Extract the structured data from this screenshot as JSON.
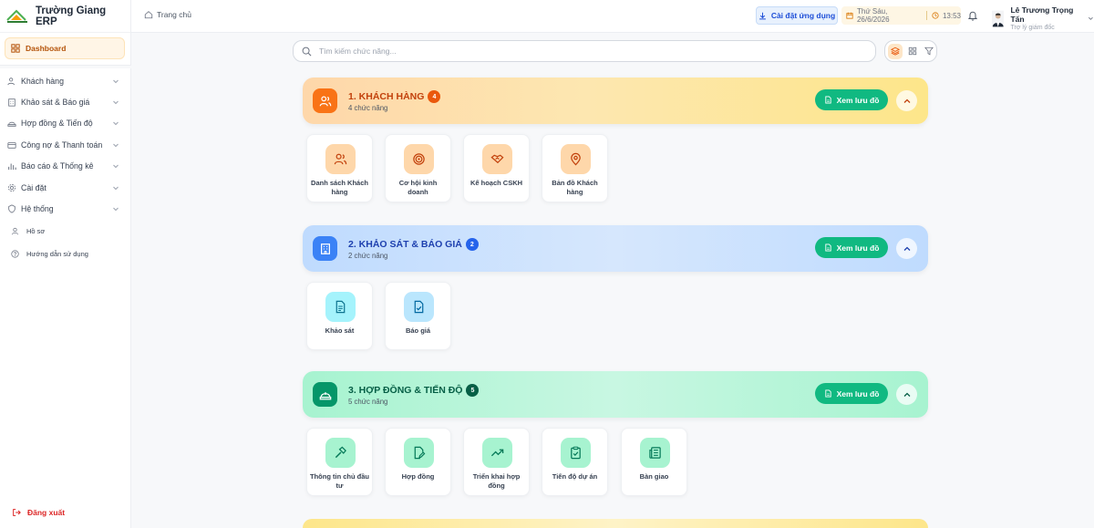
{
  "app": {
    "title": "Trường Giang ERP"
  },
  "sidebar": {
    "dashboard": "Dashboard",
    "items": [
      {
        "label": "Khách hàng",
        "icon": "users-icon"
      },
      {
        "label": "Khảo sát & Báo giá",
        "icon": "building-icon"
      },
      {
        "label": "Hợp đồng & Tiến độ",
        "icon": "hardhat-icon"
      },
      {
        "label": "Công nợ & Thanh toán",
        "icon": "card-icon"
      },
      {
        "label": "Báo cáo & Thống kê",
        "icon": "bar-chart-icon"
      },
      {
        "label": "Cài đặt",
        "icon": "gear-icon"
      },
      {
        "label": "Hệ thống",
        "icon": "shield-icon"
      }
    ],
    "subs": [
      {
        "label": "Hồ sơ",
        "icon": "user-icon"
      },
      {
        "label": "Hướng dẫn sử dụng",
        "icon": "help-icon"
      }
    ],
    "logout": "Đăng xuất"
  },
  "header": {
    "breadcrumb": "Trang chủ",
    "install_label": "Cài đặt ứng dụng",
    "date": "Thứ Sáu, 26/6/2026",
    "time": "13:53",
    "user_name": "Lê Trương Trọng Tấn",
    "user_role": "Trợ lý giám đốc"
  },
  "search": {
    "placeholder": "Tìm kiếm chức năng..."
  },
  "sections": [
    {
      "title": "1. KHÁCH HÀNG",
      "badge": "4",
      "subtitle": "4 chức năng",
      "flow_label": "Xem lưu đồ",
      "tiles": [
        "Danh sách Khách hàng",
        "Cơ hội kinh doanh",
        "Kế hoạch CSKH",
        "Bản đồ Khách hàng"
      ]
    },
    {
      "title": "2. KHẢO SÁT & BÁO GIÁ",
      "badge": "2",
      "subtitle": "2 chức năng",
      "flow_label": "Xem lưu đồ",
      "tiles": [
        "Khảo sát",
        "Báo giá"
      ]
    },
    {
      "title": "3. HỢP ĐỒNG & TIẾN ĐỘ",
      "badge": "5",
      "subtitle": "5 chức năng",
      "flow_label": "Xem lưu đồ",
      "tiles": [
        "Thông tin chủ đầu tư",
        "Hợp đồng",
        "Triển khai hợp đồng",
        "Tiến độ dự án",
        "Bàn giao"
      ]
    }
  ],
  "colors": {
    "accent": "#f97316",
    "section1": "#fde68a",
    "section2": "#bfdbfe",
    "section3": "#a7f3d0",
    "flow_button": "#10b981"
  }
}
